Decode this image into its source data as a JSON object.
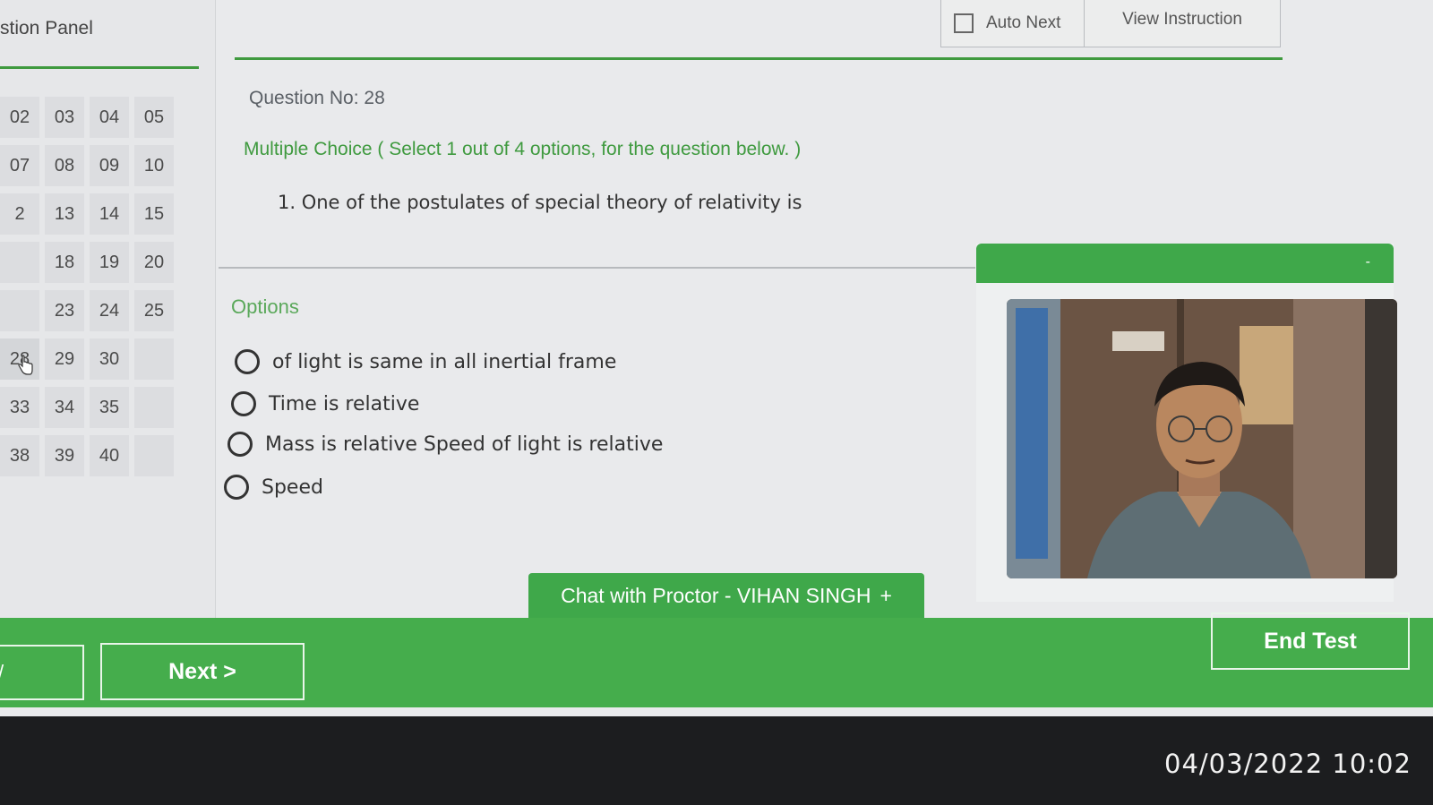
{
  "panel": {
    "title": "stion Panel",
    "questions": [
      "02",
      "03",
      "04",
      "05",
      "07",
      "08",
      "09",
      "10",
      "2",
      "13",
      "14",
      "15",
      "",
      "18",
      "19",
      "20",
      "",
      "23",
      "24",
      "25",
      "28",
      "29",
      "30",
      "",
      "33",
      "34",
      "35",
      "",
      "38",
      "39",
      "40",
      ""
    ],
    "current": "28"
  },
  "header": {
    "auto_next_label": "Auto Next",
    "view_instruction_label": "View Instruction"
  },
  "question": {
    "number_label": "Question No: 28",
    "type_label": "Multiple Choice ( Select 1 out of 4 options, for the question below. )",
    "text": "1. One of the postulates of special theory of relativity is"
  },
  "options": {
    "label": "Options",
    "items": [
      "of light is same in all inertial frame",
      "Time is relative",
      "Mass is relative Speed of light is relative",
      "Speed"
    ]
  },
  "proctor": {
    "chat_label": "Chat with Proctor - VIHAN SINGH",
    "chat_plus": "+",
    "minimize": "-"
  },
  "footer": {
    "prev_label": "/",
    "next_label": "Next >",
    "end_label": "End Test"
  },
  "photo": {
    "timestamp": "04/03/2022 10:02"
  },
  "colors": {
    "accent_green": "#45ad4c",
    "line_green": "#3f9a3f"
  }
}
